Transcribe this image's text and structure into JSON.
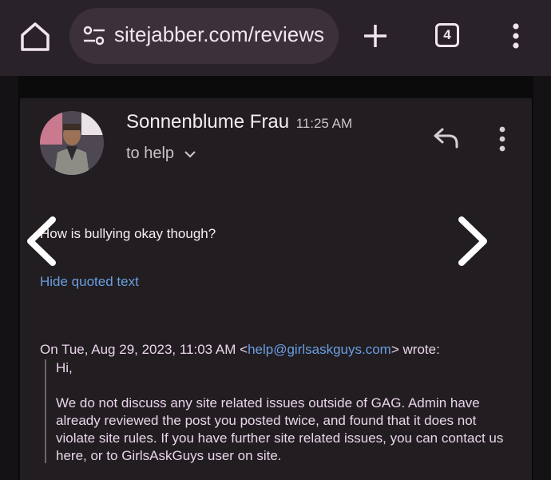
{
  "browser": {
    "url": "sitejabber.com/reviews",
    "tab_count": "4",
    "icons": [
      "home-icon",
      "tune-icon",
      "plus-icon",
      "tab-switcher-icon",
      "more-vert-icon"
    ]
  },
  "email": {
    "sender_name": "Sonnenblume Frau",
    "time": "11:25 AM",
    "to": "to help",
    "body": "How is bullying okay though?",
    "hide_quoted": "Hide quoted text",
    "quote_header_prefix": "On Tue, Aug 29, 2023, 11:03 AM <",
    "quote_email": "help@girlsaskguys.com",
    "quote_header_suffix": "> wrote:",
    "quote_greeting": "Hi,",
    "quote_body": "We do not discuss any site related issues outside of GAG. Admin have already reviewed the post you posted twice, and found that it does not violate site rules. If you have further site related issues, you can contact us here, or to GirlsAskGuys user on site."
  },
  "colors": {
    "background": "#1d1a1e",
    "card": "#211d21",
    "link": "#6b9ee0",
    "quote_text": "#ead5ea"
  }
}
